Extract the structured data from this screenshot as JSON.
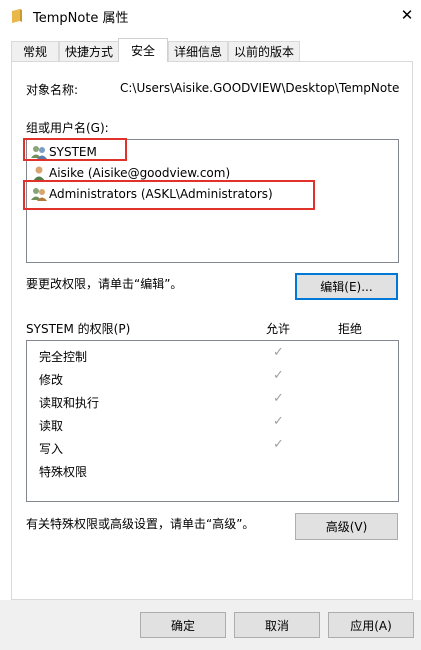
{
  "window": {
    "title": "TempNote 属性",
    "close_symbol": "✕"
  },
  "tabs": [
    {
      "label": "常规",
      "active": false
    },
    {
      "label": "快捷方式",
      "active": false
    },
    {
      "label": "安全",
      "active": true
    },
    {
      "label": "详细信息",
      "active": false
    },
    {
      "label": "以前的版本",
      "active": false
    }
  ],
  "object": {
    "label": "对象名称:",
    "value": "C:\\Users\\Aisike.GOODVIEW\\Desktop\\TempNote"
  },
  "groups": {
    "label": "组或用户名(G):",
    "items": [
      {
        "name": "SYSTEM",
        "icon": "group-icon",
        "highlighted": true
      },
      {
        "name": "Aisike (Aisike@goodview.com)",
        "icon": "user-icon",
        "highlighted": false
      },
      {
        "name": "Administrators (ASKL\\Administrators)",
        "icon": "group-icon",
        "highlighted": true
      }
    ]
  },
  "edit_hint": "要更改权限，请单击“编辑”。",
  "edit_button": "编辑(E)...",
  "permissions": {
    "label": "SYSTEM 的权限(P)",
    "allow_header": "允许",
    "deny_header": "拒绝",
    "rows": [
      {
        "name": "完全控制",
        "allow": true,
        "deny": false
      },
      {
        "name": "修改",
        "allow": true,
        "deny": false
      },
      {
        "name": "读取和执行",
        "allow": true,
        "deny": false
      },
      {
        "name": "读取",
        "allow": true,
        "deny": false
      },
      {
        "name": "写入",
        "allow": true,
        "deny": false
      },
      {
        "name": "特殊权限",
        "allow": false,
        "deny": false
      }
    ],
    "check_symbol": "✓"
  },
  "advanced_hint": "有关特殊权限或高级设置，请单击“高级”。",
  "advanced_button": "高级(V)",
  "footer": {
    "ok": "确定",
    "cancel": "取消",
    "apply": "应用(A)"
  },
  "colors": {
    "highlight": "#e0312a",
    "focus": "#0078d7"
  }
}
